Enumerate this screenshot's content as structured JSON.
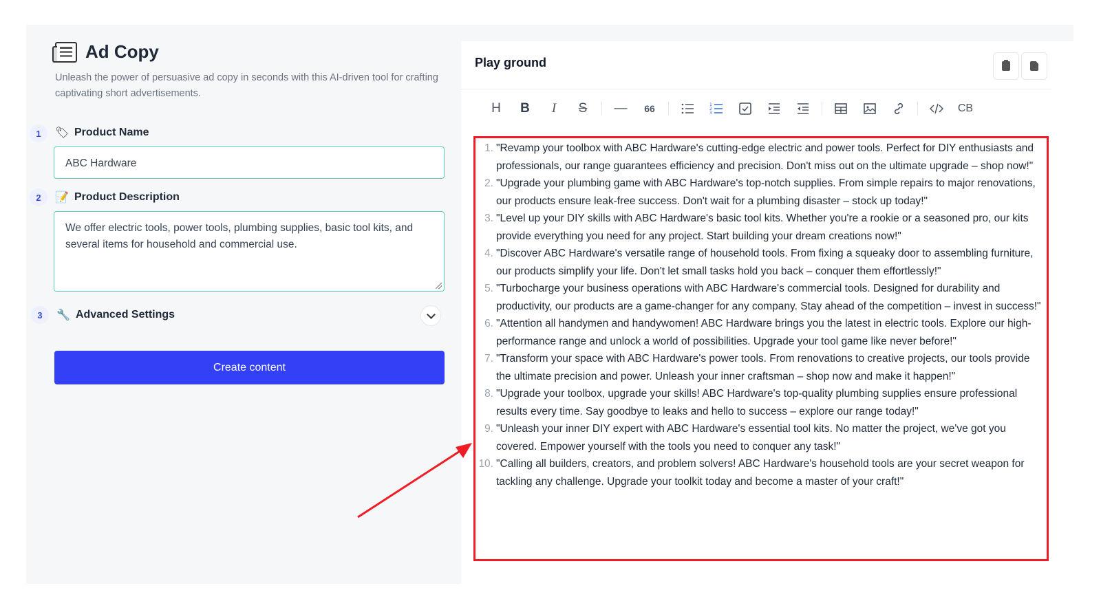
{
  "left_panel": {
    "title": "Ad Copy",
    "subtitle": "Unleash the power of persuasive ad copy in seconds with this AI-driven tool for crafting captivating short advertisements.",
    "steps": [
      {
        "number": "1",
        "icon": "tag-icon",
        "label": "Product Name",
        "value": "ABC Hardware"
      },
      {
        "number": "2",
        "icon": "memo-icon",
        "label": "Product Description",
        "value": "We offer electric tools, power tools, plumbing supplies, basic tool kits, and several items for household and commercial use."
      },
      {
        "number": "3",
        "icon": "wrench-icon",
        "label": "Advanced Settings"
      }
    ],
    "create_button": "Create content"
  },
  "playground": {
    "title": "Play ground",
    "header_buttons": [
      "clipboard-icon",
      "document-icon"
    ],
    "toolbar": {
      "heading": "H",
      "bold": "B",
      "italic": "I",
      "quote": "66",
      "codeblock": "CB"
    },
    "ads": [
      {
        "n": "1.",
        "text": "\"Revamp your toolbox with ABC Hardware's cutting-edge electric and power tools. Perfect for DIY enthusiasts and professionals, our range guarantees efficiency and precision. Don't miss out on the ultimate upgrade – shop now!\""
      },
      {
        "n": "2.",
        "text": "\"Upgrade your plumbing game with ABC Hardware's top-notch supplies. From simple repairs to major renovations, our products ensure leak-free success. Don't wait for a plumbing disaster – stock up today!\""
      },
      {
        "n": "3.",
        "text": "\"Level up your DIY skills with ABC Hardware's basic tool kits. Whether you're a rookie or a seasoned pro, our kits provide everything you need for any project. Start building your dream creations now!\""
      },
      {
        "n": "4.",
        "text": "\"Discover ABC Hardware's versatile range of household tools. From fixing a squeaky door to assembling furniture, our products simplify your life. Don't let small tasks hold you back – conquer them effortlessly!\""
      },
      {
        "n": "5.",
        "text": "\"Turbocharge your business operations with ABC Hardware's commercial tools. Designed for durability and productivity, our products are a game-changer for any company. Stay ahead of the competition – invest in success!\""
      },
      {
        "n": "6.",
        "text": "\"Attention all handymen and handywomen! ABC Hardware brings you the latest in electric tools. Explore our high-performance range and unlock a world of possibilities. Upgrade your tool game like never before!\""
      },
      {
        "n": "7.",
        "text": "\"Transform your space with ABC Hardware's power tools. From renovations to creative projects, our tools provide the ultimate precision and power. Unleash your inner craftsman – shop now and make it happen!\""
      },
      {
        "n": "8.",
        "text": "\"Upgrade your toolbox, upgrade your skills! ABC Hardware's top-quality plumbing supplies ensure professional results every time. Say goodbye to leaks and hello to success – explore our range today!\""
      },
      {
        "n": "9.",
        "text": "\"Unleash your inner DIY expert with ABC Hardware's essential tool kits. No matter the project, we've got you covered. Empower yourself with the tools you need to conquer any task!\""
      },
      {
        "n": "10.",
        "text": "\"Calling all builders, creators, and problem solvers! ABC Hardware's household tools are your secret weapon for tackling any challenge. Upgrade your toolkit today and become a master of your craft!\""
      }
    ]
  },
  "colors": {
    "accent": "#3340f5",
    "input_border": "#5ccbc0",
    "highlight": "#ee1c25"
  }
}
